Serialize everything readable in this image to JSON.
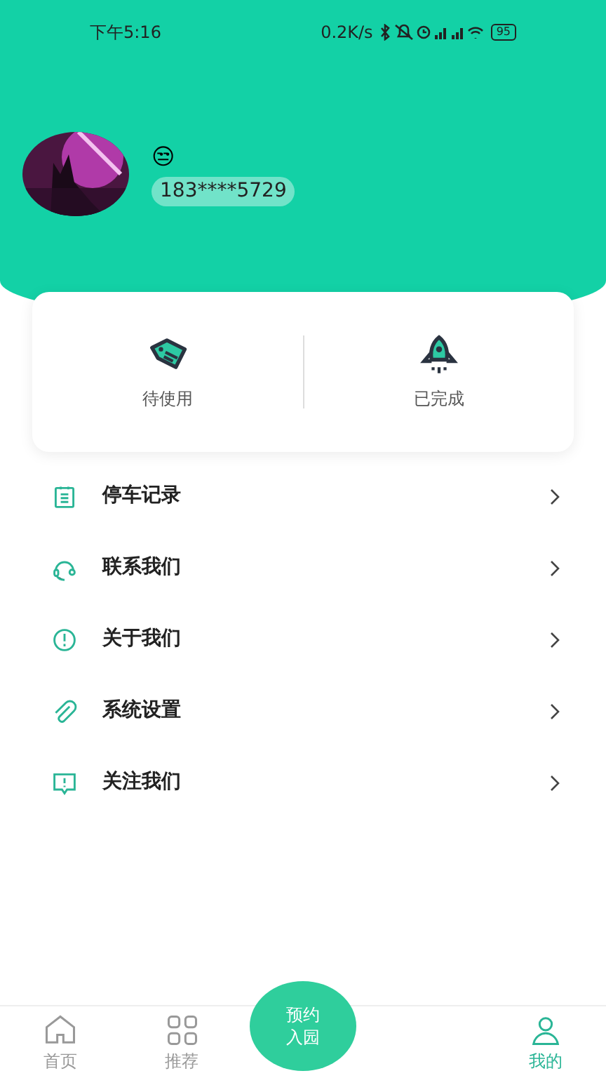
{
  "status_bar": {
    "time": "下午5:16",
    "speed": "0.2K/s",
    "battery": "95"
  },
  "profile": {
    "emoji": "😒",
    "phone": "183****5729"
  },
  "orders": [
    {
      "label": "待使用",
      "kind": "tag"
    },
    {
      "label": "已完成",
      "kind": "rocket"
    }
  ],
  "menu": [
    {
      "label": "停车记录",
      "kind": "list"
    },
    {
      "label": "联系我们",
      "kind": "headset"
    },
    {
      "label": "关于我们",
      "kind": "info"
    },
    {
      "label": "系统设置",
      "kind": "clip"
    },
    {
      "label": "关注我们",
      "kind": "alert"
    }
  ],
  "tab_bar": {
    "center": "预约入园",
    "tabs": [
      {
        "label": "首页",
        "kind": "home",
        "selected": false
      },
      {
        "label": "推荐",
        "kind": "grid",
        "selected": false
      },
      {
        "label": "我的",
        "kind": "person",
        "selected": true
      }
    ]
  }
}
